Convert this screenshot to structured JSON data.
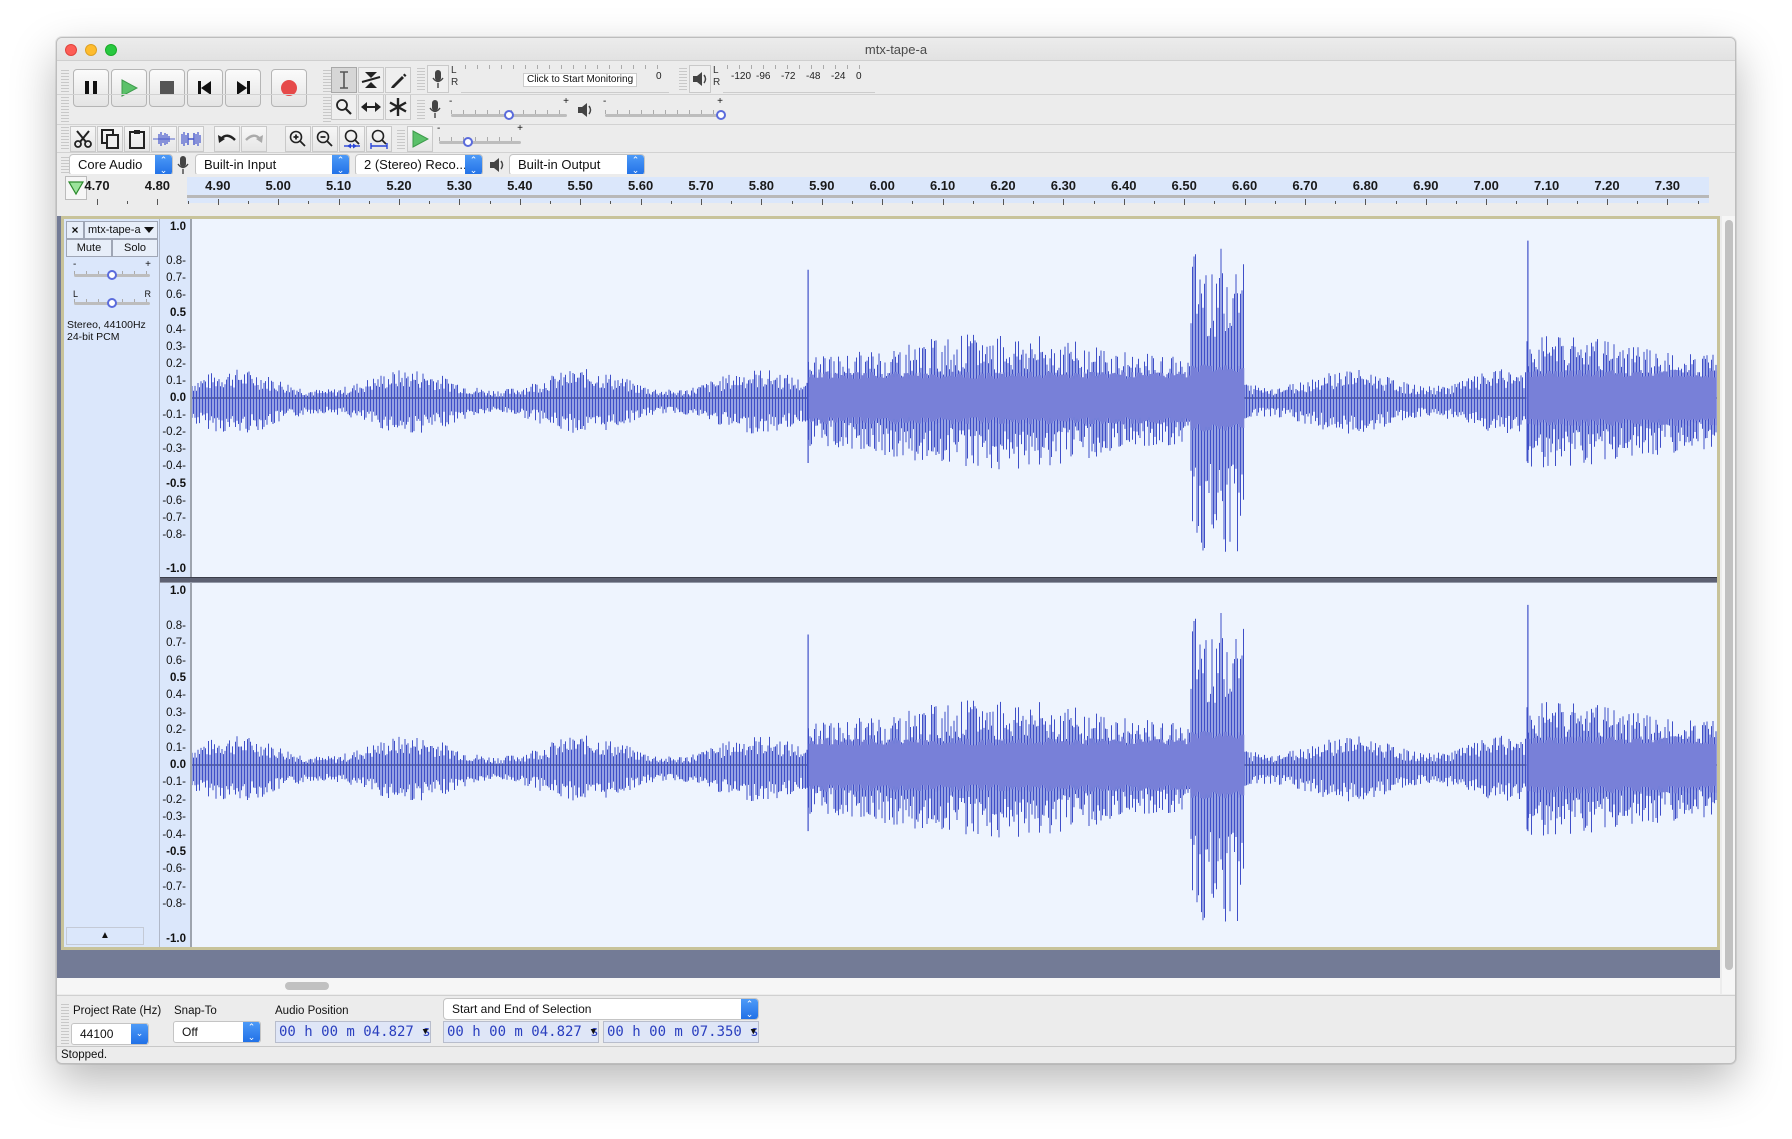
{
  "window": {
    "title": "mtx-tape-a"
  },
  "transport": {
    "buttons": [
      {
        "name": "pause-button",
        "icon": "pause-icon"
      },
      {
        "name": "play-button",
        "icon": "play-icon"
      },
      {
        "name": "stop-button",
        "icon": "stop-icon"
      },
      {
        "name": "skip-to-start-button",
        "icon": "skip-start-icon"
      },
      {
        "name": "skip-to-end-button",
        "icon": "skip-end-icon"
      },
      {
        "name": "record-button",
        "icon": "record-icon"
      }
    ]
  },
  "tools": {
    "items": [
      {
        "name": "selection-tool",
        "icon": "i-beam-icon",
        "active": true
      },
      {
        "name": "envelope-tool",
        "icon": "envelope-icon",
        "active": false
      },
      {
        "name": "draw-tool",
        "icon": "pencil-icon",
        "active": false
      },
      {
        "name": "zoom-tool",
        "icon": "magnifier-icon",
        "active": false
      },
      {
        "name": "time-shift-tool",
        "icon": "double-arrow-icon",
        "active": false
      },
      {
        "name": "multi-tool",
        "icon": "asterisk-icon",
        "active": false
      }
    ]
  },
  "record_meter": {
    "l": "L",
    "r": "R",
    "monitor_label": "Click to Start Monitoring",
    "zero_label": "0"
  },
  "play_meter": {
    "l": "L",
    "r": "R",
    "scale": [
      "-120",
      "-96",
      "-72",
      "-48",
      "-24",
      "0"
    ]
  },
  "mixer": {
    "record_volume": 0.5,
    "playback_volume": 1.0,
    "minus": "-",
    "plus": "+"
  },
  "play_at_speed": {
    "speed": 0.35,
    "minus": "-",
    "plus": "+"
  },
  "devices": {
    "host": "Core Audio",
    "input": "Built-in Input",
    "channels": "2 (Stereo) Reco...",
    "output": "Built-in Output"
  },
  "ruler": {
    "ticks": [
      "4.70",
      "4.80",
      "4.90",
      "5.00",
      "5.10",
      "5.20",
      "5.30",
      "5.40",
      "5.50",
      "5.60",
      "5.70",
      "5.80",
      "5.90",
      "6.00",
      "6.10",
      "6.20",
      "6.30",
      "6.40",
      "6.50",
      "6.60",
      "6.70",
      "6.80",
      "6.90",
      "7.00",
      "7.10",
      "7.20",
      "7.30"
    ]
  },
  "track": {
    "name": "mtx-tape-a",
    "close": "×",
    "mute": "Mute",
    "solo": "Solo",
    "gain_minus": "-",
    "gain_plus": "+",
    "pan_l": "L",
    "pan_r": "R",
    "gain": 0.5,
    "pan": 0.5,
    "info_line1": "Stereo, 44100Hz",
    "info_line2": "24-bit PCM",
    "collapse": "▲",
    "vscale": [
      {
        "v": "1.0",
        "bold": true,
        "pos": 1.0
      },
      {
        "v": "0.8",
        "bold": false,
        "pos": 0.8
      },
      {
        "v": "0.7",
        "bold": false,
        "pos": 0.7
      },
      {
        "v": "0.6",
        "bold": false,
        "pos": 0.6
      },
      {
        "v": "0.5",
        "bold": true,
        "pos": 0.5
      },
      {
        "v": "0.4",
        "bold": false,
        "pos": 0.4
      },
      {
        "v": "0.3",
        "bold": false,
        "pos": 0.3
      },
      {
        "v": "0.2",
        "bold": false,
        "pos": 0.2
      },
      {
        "v": "0.1",
        "bold": false,
        "pos": 0.1
      },
      {
        "v": "0.0",
        "bold": true,
        "pos": 0.0
      },
      {
        "v": "-0.1",
        "bold": false,
        "pos": -0.1
      },
      {
        "v": "-0.2",
        "bold": false,
        "pos": -0.2
      },
      {
        "v": "-0.3",
        "bold": false,
        "pos": -0.3
      },
      {
        "v": "-0.4",
        "bold": false,
        "pos": -0.4
      },
      {
        "v": "-0.5",
        "bold": true,
        "pos": -0.5
      },
      {
        "v": "-0.6",
        "bold": false,
        "pos": -0.6
      },
      {
        "v": "-0.7",
        "bold": false,
        "pos": -0.7
      },
      {
        "v": "-0.8",
        "bold": false,
        "pos": -0.8
      },
      {
        "v": "-1.0",
        "bold": true,
        "pos": -1.0
      }
    ],
    "waveform_color": "#3f4fc8",
    "waveform_rms_color": "#7880d8",
    "background_color": "#eef4fe"
  },
  "selection_toolbar": {
    "project_rate_label": "Project Rate (Hz)",
    "project_rate_value": "44100",
    "snap_to_label": "Snap-To",
    "snap_to_value": "Off",
    "audio_position_label": "Audio Position",
    "audio_position_value": "00 h 00 m 04.827 s",
    "selection_mode": "Start and End of Selection",
    "selection_start": "00 h 00 m 04.827 s",
    "selection_end": "00 h 00 m 07.350 s"
  },
  "status": {
    "text": "Stopped."
  }
}
